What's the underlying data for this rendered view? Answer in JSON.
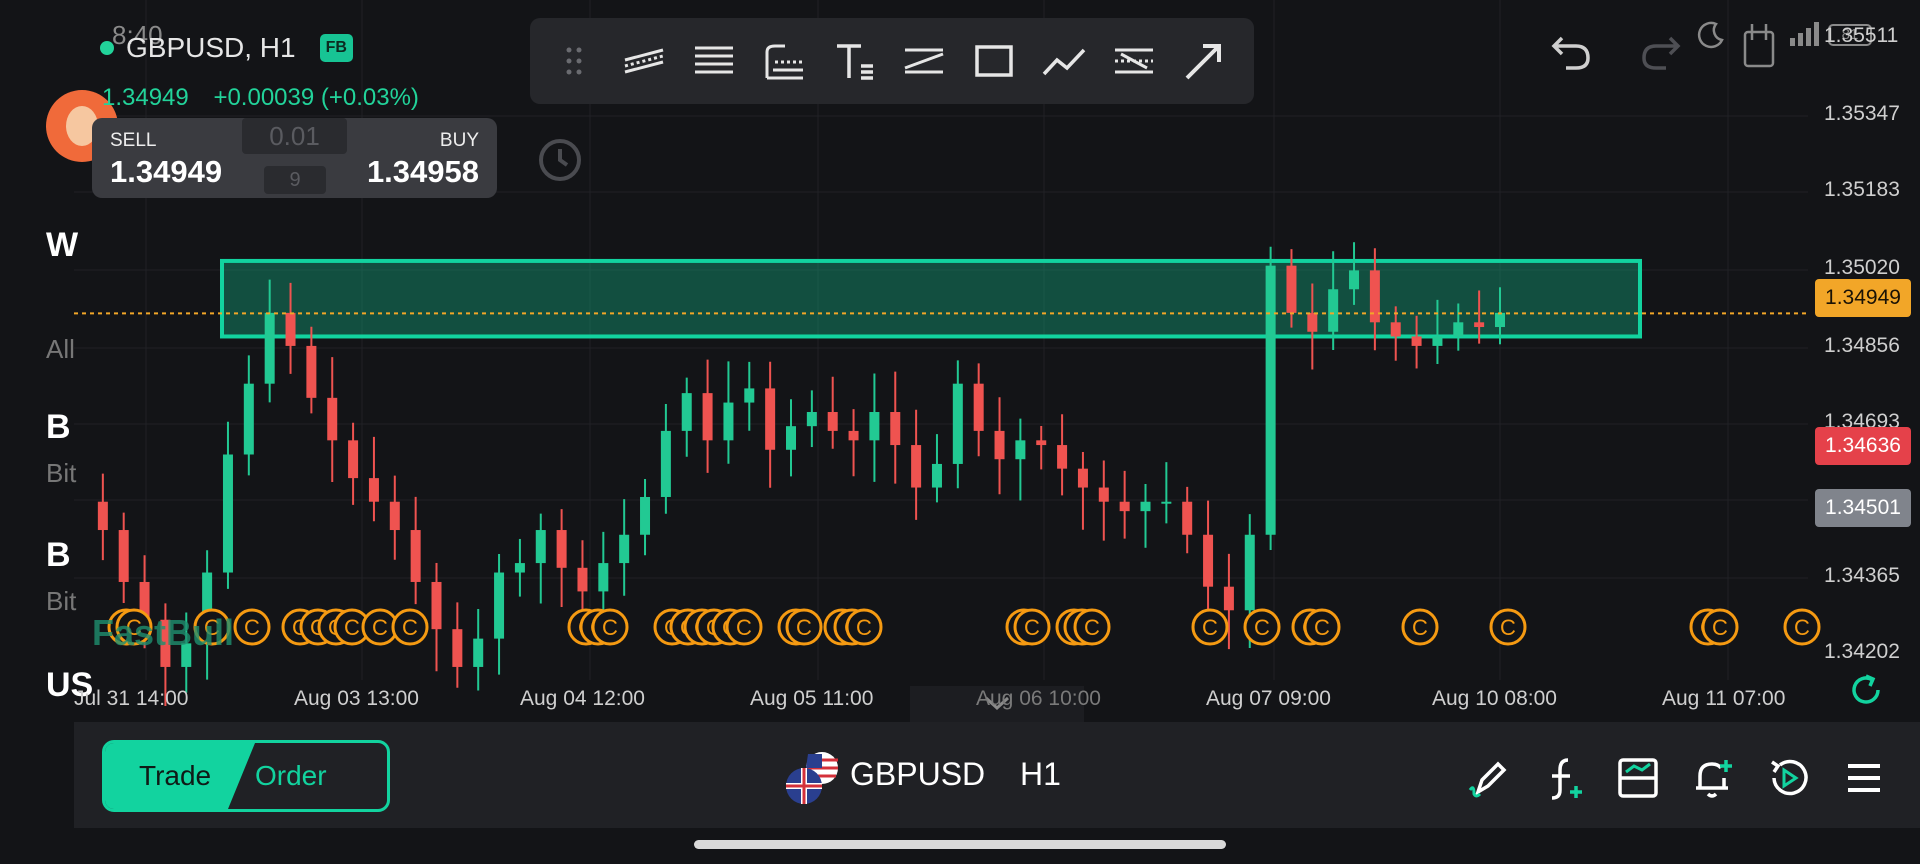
{
  "status_bar": {
    "time": "8:40",
    "battery": "81"
  },
  "symbol_header": {
    "title": "GBPUSD, H1",
    "badge": "FB",
    "last_price": "1.34949",
    "change": "+0.00039 (+0.03%)"
  },
  "trade_panel": {
    "sell_label": "SELL",
    "sell_price": "1.34949",
    "buy_label": "BUY",
    "buy_price": "1.34958",
    "lot": "0.01",
    "spread": "9"
  },
  "sidebar_fragments": [
    "W",
    "All",
    "B",
    "Bit",
    "B",
    "Bit",
    "US"
  ],
  "watermark": "FastBull",
  "drawing_tools": [
    "drag-handle",
    "parallel-channel",
    "fib-retracement",
    "fib-fan",
    "text",
    "price-range",
    "rectangle",
    "polyline",
    "horizontal-ray",
    "arrow"
  ],
  "price_axis": {
    "labels": [
      "1.35511",
      "1.35347",
      "1.35183",
      "1.35020",
      "1.34856",
      "1.34693",
      "1.34365",
      "1.34202"
    ],
    "current_price_tag": "1.34949",
    "high_tag": "1.34636",
    "low_tag": "1.34501"
  },
  "time_axis": {
    "labels": [
      "Jul 31 14:00",
      "Aug 03 13:00",
      "Aug 04 12:00",
      "Aug 05 11:00",
      "Aug 06 10:00",
      "Aug 07 09:00",
      "Aug 10 08:00",
      "Aug 11 07:00"
    ]
  },
  "event_marker_glyph": "C",
  "colors": {
    "up": "#22c993",
    "down": "#ef5350",
    "accent": "#12d39f",
    "current": "#f2a628",
    "high_tag": "#e5414a",
    "low_tag": "#80848c",
    "event": "#f59a12"
  },
  "bottom_bar": {
    "trade_label": "Trade",
    "order_label": "Order",
    "symbol": "GBPUSD",
    "timeframe": "H1"
  },
  "chart_data": {
    "type": "candlestick",
    "symbol": "GBPUSD",
    "timeframe": "H1",
    "ylim": [
      1.34202,
      1.356
    ],
    "current_price": 1.34949,
    "highlight_zone": {
      "low": 1.349,
      "high": 1.3506
    },
    "close_series": [
      1.3455,
      1.3449,
      1.3438,
      1.343,
      1.342,
      1.3425,
      1.344,
      1.3465,
      1.348,
      1.3495,
      1.3488,
      1.3477,
      1.3468,
      1.346,
      1.3455,
      1.3449,
      1.3438,
      1.3428,
      1.342,
      1.3426,
      1.344,
      1.3442,
      1.3449,
      1.3441,
      1.3436,
      1.3442,
      1.3448,
      1.3456,
      1.347,
      1.3478,
      1.3468,
      1.3476,
      1.3479,
      1.3466,
      1.3471,
      1.3474,
      1.347,
      1.3468,
      1.3474,
      1.3467,
      1.3458,
      1.3463,
      1.348,
      1.347,
      1.3464,
      1.3468,
      1.3467,
      1.3462,
      1.3458,
      1.3455,
      1.3453,
      1.3455,
      1.3455,
      1.3448,
      1.3437,
      1.3432,
      1.3448,
      1.3505,
      1.3495,
      1.3491,
      1.35,
      1.3504,
      1.3493,
      1.349,
      1.3488,
      1.349,
      1.3493,
      1.3492,
      1.3495
    ],
    "event_marker_count": 35
  }
}
